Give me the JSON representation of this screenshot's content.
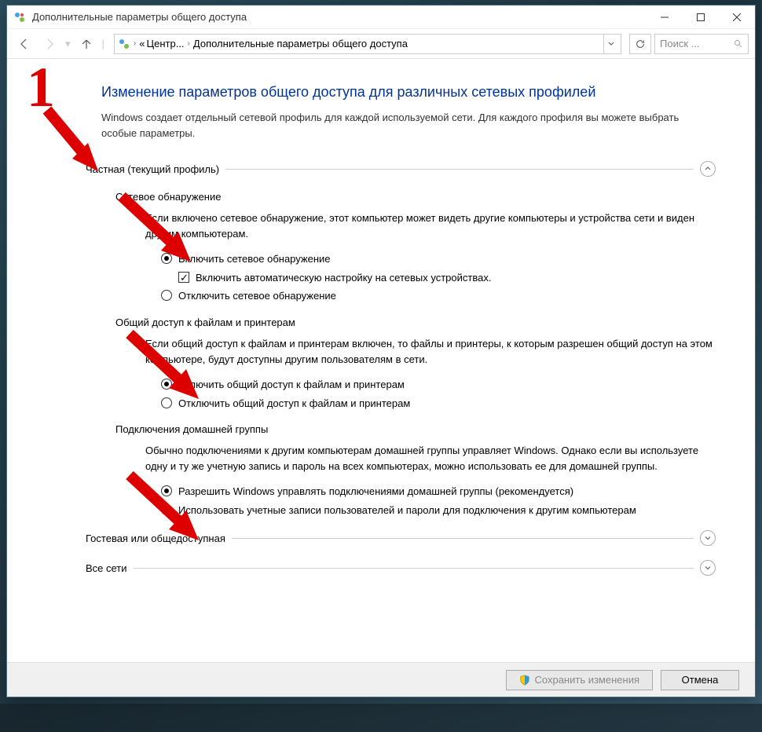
{
  "annotation": {
    "big_number": "1"
  },
  "window": {
    "title": "Дополнительные параметры общего доступа"
  },
  "nav": {
    "breadcrumb": [
      "«",
      "Центр...",
      "Дополнительные параметры общего доступа"
    ],
    "search_placeholder": "Поиск ..."
  },
  "page": {
    "title": "Изменение параметров общего доступа для различных сетевых профилей",
    "description": "Windows создает отдельный сетевой профиль для каждой используемой сети. Для каждого профиля вы можете выбрать особые параметры."
  },
  "sections": {
    "private": {
      "header": "Частная (текущий профиль)",
      "discovery": {
        "title": "Сетевое обнаружение",
        "desc": "Если включено сетевое обнаружение, этот компьютер может видеть другие компьютеры и устройства сети и виден другим компьютерам.",
        "opt_on": "Включить сетевое обнаружение",
        "opt_on_auto": "Включить автоматическую настройку на сетевых устройствах.",
        "opt_off": "Отключить сетевое обнаружение"
      },
      "fileshare": {
        "title": "Общий доступ к файлам и принтерам",
        "desc": "Если общий доступ к файлам и принтерам включен, то файлы и принтеры, к которым разрешен общий доступ на этом компьютере, будут доступны другим пользователям в сети.",
        "opt_on": "Включить общий доступ к файлам и принтерам",
        "opt_off": "Отключить общий доступ к файлам и принтерам"
      },
      "homegroup": {
        "title": "Подключения домашней группы",
        "desc": "Обычно подключениями к другим компьютерам домашней группы управляет Windows. Однако если вы используете одну и ту же учетную запись и пароль на всех компьютерах, можно использовать ее для домашней группы.",
        "opt_win": "Разрешить Windows управлять подключениями домашней группы (рекомендуется)",
        "opt_user": "Использовать учетные записи пользователей и пароли для подключения к другим компьютерам"
      }
    },
    "guest": {
      "header": "Гостевая или общедоступная"
    },
    "all": {
      "header": "Все сети"
    }
  },
  "footer": {
    "save": "Сохранить изменения",
    "cancel": "Отмена"
  }
}
